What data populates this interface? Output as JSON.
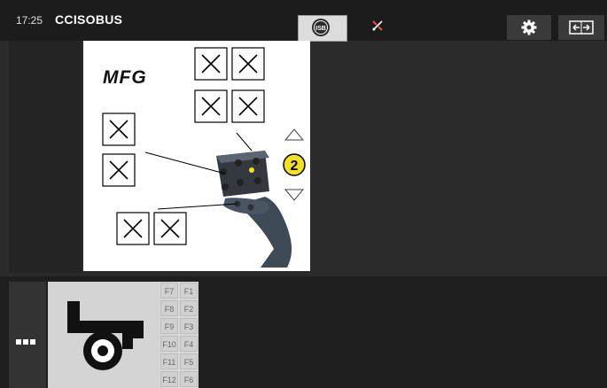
{
  "statusbar": {
    "time": "17:25",
    "brand": "CCISOBUS",
    "isb_label": "ISB"
  },
  "joystick": {
    "label": "MFG",
    "level": "2"
  },
  "function_keys": {
    "left": [
      "F7",
      "F8",
      "F9",
      "F10",
      "F11",
      "F12"
    ],
    "right": [
      "F1",
      "F2",
      "F3",
      "F4",
      "F5",
      "F6"
    ]
  },
  "icons": {
    "isb": "isb-circle-icon",
    "no_connection": "no-connection-icon",
    "settings": "gear-icon",
    "switch": "switch-screens-icon",
    "menu": "more-menu-icon",
    "implement": "implement-icon"
  },
  "colors": {
    "background": "#2b2b2b",
    "topbar": "#1c1c1c",
    "level_badge": "#f3e21b",
    "no_connection": "#e05050"
  }
}
